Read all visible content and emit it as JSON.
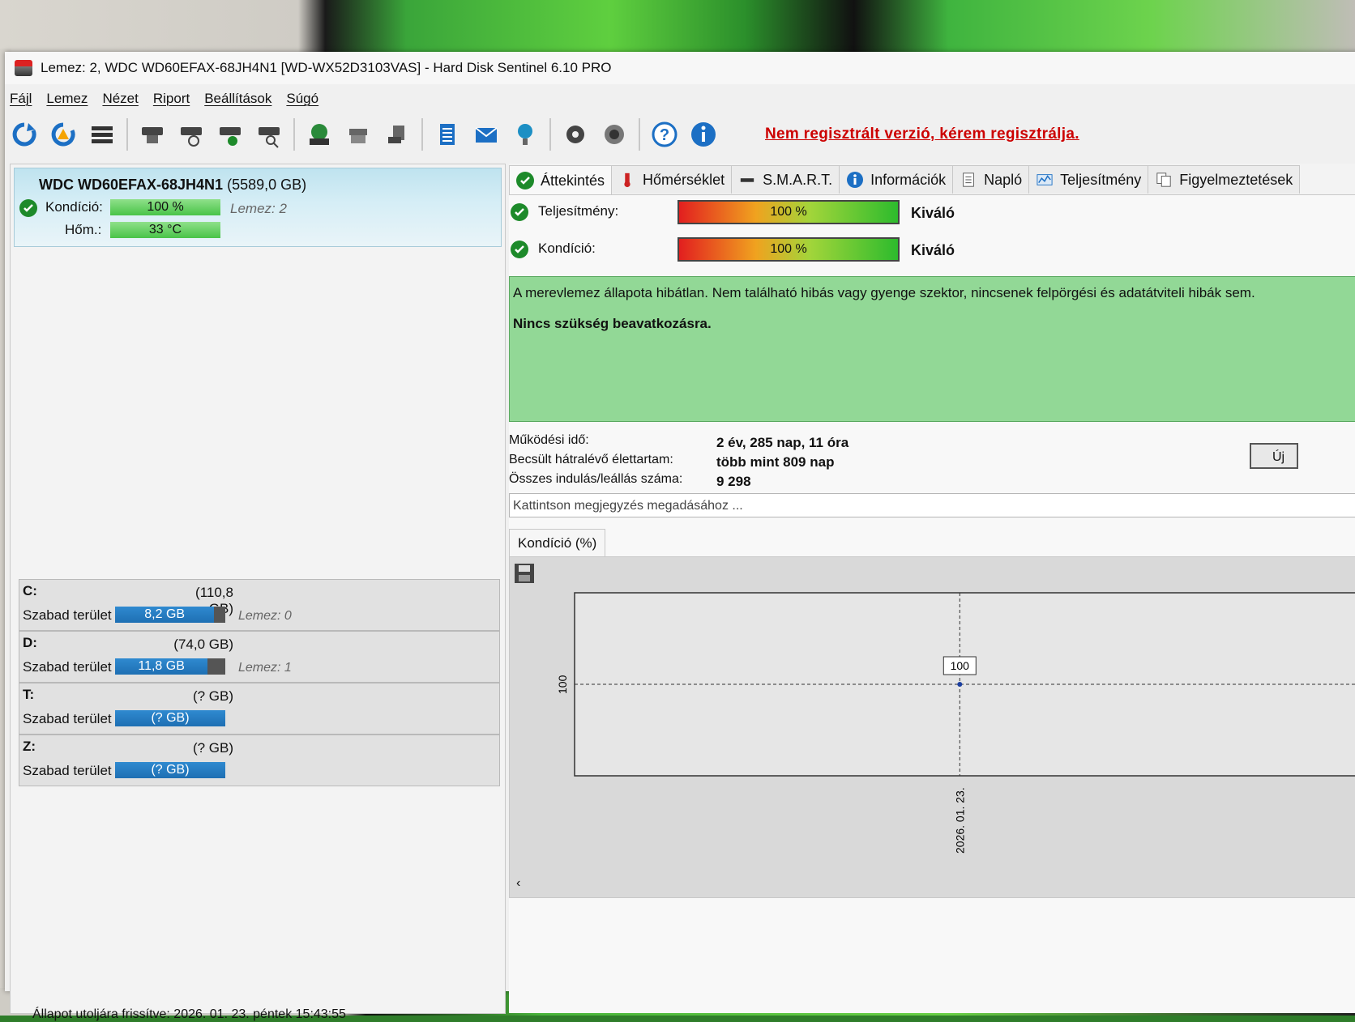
{
  "window": {
    "title": "Lemez: 2, WDC WD60EFAX-68JH4N1 [WD-WX52D3103VAS]  -  Hard Disk Sentinel 6.10 PRO"
  },
  "menu": [
    "Fájl",
    "Lemez",
    "Nézet",
    "Riport",
    "Beállítások",
    "Súgó"
  ],
  "toolbar": {
    "warning": "Nem regisztrált verzió, kérem regisztrálja."
  },
  "disk": {
    "model": "WDC WD60EFAX-68JH4N1",
    "size": "(5589,0 GB)",
    "condition_label": "Kondíció:",
    "condition_value": "100 %",
    "condition_fraction": 1.0,
    "disk_number": "Lemez: 2",
    "temp_label": "Hőm.:",
    "temp_value": "33 °C"
  },
  "drives": [
    {
      "letter": "C:",
      "size": "(110,8 GB)",
      "free_label": "Szabad terület",
      "free": "8,2 GB",
      "free_fraction": 0.9,
      "disk": "Lemez: 0"
    },
    {
      "letter": "D:",
      "size": "(74,0 GB)",
      "free_label": "Szabad terület",
      "free": "11,8 GB",
      "free_fraction": 0.84,
      "disk": "Lemez: 1"
    },
    {
      "letter": "T:",
      "size": "(? GB)",
      "free_label": "Szabad terület",
      "free": "(? GB)",
      "free_fraction": 1.0,
      "disk": ""
    },
    {
      "letter": "Z:",
      "size": "(? GB)",
      "free_label": "Szabad terület",
      "free": "(? GB)",
      "free_fraction": 1.0,
      "disk": ""
    }
  ],
  "status_bar": "Állapot utoljára frissítve: 2026. 01. 23. péntek 15:43:55",
  "tabs": [
    "Áttekintés",
    "Hőmérséklet",
    "S.M.A.R.T.",
    "Információk",
    "Napló",
    "Teljesítmény",
    "Figyelmeztetések"
  ],
  "overview": {
    "performance_label": "Teljesítmény:",
    "performance_value": "100 %",
    "performance_rating": "Kiváló",
    "condition_label": "Kondíció:",
    "condition_value": "100 %",
    "condition_rating": "Kiváló",
    "message_line1": "A merevlemez állapota hibátlan. Nem található hibás vagy gyenge szektor, nincsenek felpörgési és adatátviteli hibák sem.",
    "message_line2": "Nincs szükség beavatkozásra.",
    "uptime_label": "Működési idő:",
    "uptime_value": "2 év, 285 nap, 11 óra",
    "lifetime_label": "Becsült hátralévő élettartam:",
    "lifetime_value": "több mint 809 nap",
    "startstop_label": "Összes indulás/leállás száma:",
    "startstop_value": "9 298",
    "new_button": "Új",
    "note_placeholder": "Kattintson megjegyzés megadásához ...",
    "chart_tab": "Kondíció  (%)"
  },
  "chart_data": {
    "type": "line",
    "x": [
      "2026. 01. 23."
    ],
    "series": [
      {
        "values": [
          100
        ]
      }
    ],
    "y_tick": "100",
    "point_label": "100",
    "ylim": [
      0,
      200
    ]
  },
  "colors": {
    "ok_green": "#1d8a2a",
    "warning_red": "#cc0000",
    "message_bg": "#92d896",
    "free_bar_blue": "#1e6fb3"
  }
}
